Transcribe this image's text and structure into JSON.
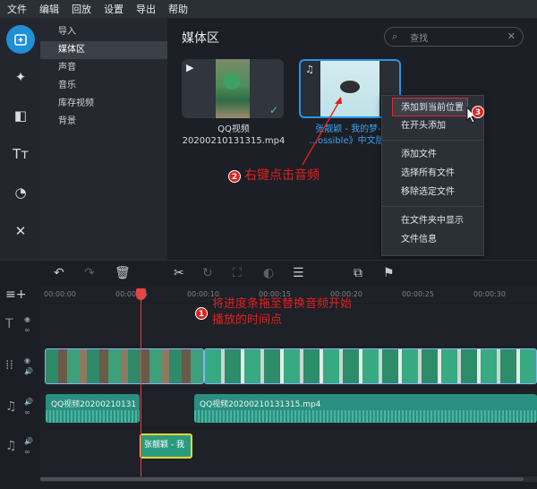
{
  "menu": [
    "文件",
    "编辑",
    "回放",
    "设置",
    "导出",
    "帮助"
  ],
  "sidebar": {
    "categories": [
      "导入",
      "媒体区",
      "声音",
      "音乐",
      "库存视频",
      "背景"
    ],
    "selected_index": 1
  },
  "media": {
    "title": "媒体区",
    "search_placeholder": "查找",
    "items": [
      {
        "name_line1": "QQ视频",
        "name_line2": "20200210131315.mp4",
        "type": "video-icon",
        "added": true
      },
      {
        "name_line1": "张靓颖 - 我的梦-华",
        "name_line2": "...ossible》中文版.m",
        "type": "music-icon",
        "added": false
      }
    ]
  },
  "context_menu": {
    "items": [
      {
        "label": "添加到当前位置",
        "highlighted": true
      },
      {
        "label": "在开头添加"
      },
      {
        "label": "添加文件"
      },
      {
        "label": "选择所有文件"
      },
      {
        "label": "移除选定文件"
      },
      {
        "label": "在文件夹中显示"
      },
      {
        "label": "文件信息"
      }
    ]
  },
  "annotations": {
    "step1_badge": "1",
    "step1_line1": "将进度条拖至替换音频开始",
    "step1_line2": "播放的时间点",
    "step2_badge": "2",
    "step2_text": "右键点击音频",
    "step3_badge": "3"
  },
  "timeline": {
    "ruler": [
      "00:00:00",
      "00:00:05",
      "00:00:10",
      "00:00:15",
      "00:00:20",
      "00:00:25",
      "00:00:30"
    ],
    "audio_clip_1": "QQ视频20200210131",
    "audio_clip_2": "QQ视频20200210131315.mp4",
    "music_clip": "张靓颖 - 我"
  },
  "colors": {
    "accent": "#1f8fd6",
    "annotation_red": "#e02020",
    "selection_blue": "#2c93e8"
  }
}
